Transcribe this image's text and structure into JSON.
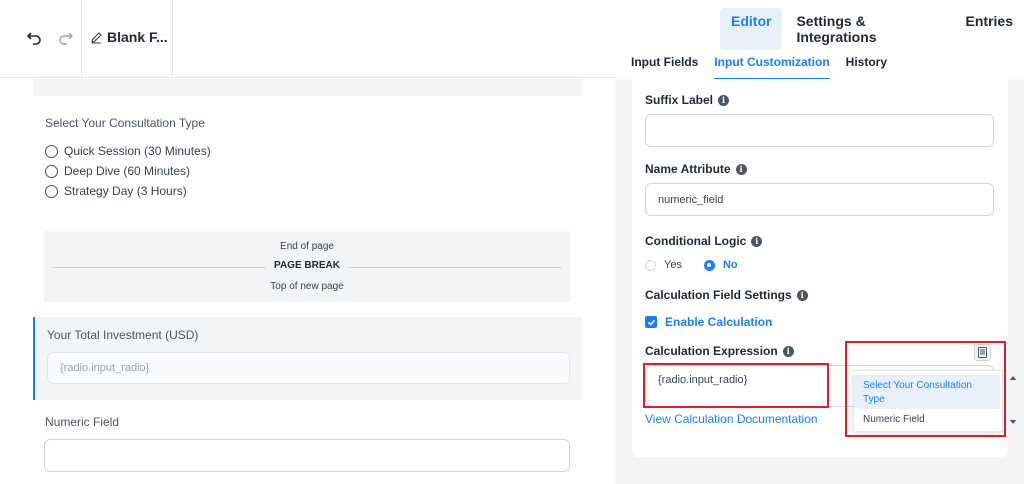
{
  "header": {
    "doc_title": "Blank F...",
    "main_tabs": [
      "Editor",
      "Settings & Integrations",
      "Entries"
    ],
    "sub_tabs": [
      "Input Fields",
      "Input Customization",
      "History"
    ]
  },
  "canvas": {
    "question_label": "Select Your Consultation Type",
    "options": [
      "Quick Session (30 Minutes)",
      "Deep Dive (60 Minutes)",
      "Strategy Day (3 Hours)"
    ],
    "page_break": {
      "top": "End of page",
      "middle": "PAGE BREAK",
      "bottom": "Top of new page"
    },
    "total_label": "Your Total Investment (USD)",
    "total_placeholder": "{radio.input_radio}",
    "numeric_label": "Numeric Field"
  },
  "settings": {
    "suffix_label": "Suffix Label",
    "name_attr_label": "Name Attribute",
    "name_attr_value": "numeric_field",
    "cond_logic_label": "Conditional Logic",
    "cond_yes": "Yes",
    "cond_no": "No",
    "calc_settings_label": "Calculation Field Settings",
    "enable_calc": "Enable Calculation",
    "calc_expr_label": "Calculation Expression",
    "calc_expr_value": "{radio.input_radio}",
    "calc_doc_link": "View Calculation Documentation"
  },
  "dropdown": {
    "items": [
      "Select Your Consultation Type",
      "Numeric Field"
    ]
  },
  "colors": {
    "accent": "#1a7efb",
    "highlight": "#e11d28"
  }
}
